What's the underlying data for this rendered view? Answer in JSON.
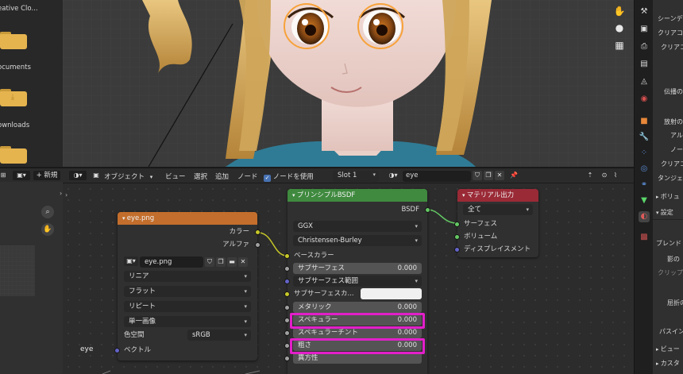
{
  "file_browser": {
    "items": [
      {
        "label": "eative Clo..."
      },
      {
        "label": "ocuments"
      },
      {
        "label": "ownloads"
      }
    ]
  },
  "image_editor": {
    "new_label": "新規"
  },
  "node_header": {
    "object_label": "オブジェクト",
    "menus": [
      "ビュー",
      "選択",
      "追加",
      "ノード"
    ],
    "use_nodes_label": "ノードを使用",
    "slot_label": "Slot 1",
    "material_name": "eye"
  },
  "nodes": {
    "image": {
      "title": "eye.png",
      "outputs": [
        "カラー",
        "アルファ"
      ],
      "image_name": "eye.png",
      "interpolation": "リニア",
      "projection": "フラット",
      "extension": "リピート",
      "source": "単一画像",
      "color_space_label": "色空間",
      "color_space_value": "sRGB",
      "vector_input": "ベクトル"
    },
    "bsdf": {
      "title": "プリンシプルBSDF",
      "output": "BSDF",
      "distribution": "GGX",
      "subsurface_method": "Christensen-Burley",
      "base_color": "ベースカラー",
      "fields": [
        {
          "label": "サブサーフェス",
          "value": "0.000"
        },
        {
          "label": "サブサーフェス範囲",
          "value": ""
        },
        {
          "label": "サブサーフェスカ...",
          "value": ""
        },
        {
          "label": "メタリック",
          "value": "0.000"
        },
        {
          "label": "スペキュラー",
          "value": "0.000"
        },
        {
          "label": "スペキュラーチント",
          "value": "0.000"
        },
        {
          "label": "粗さ",
          "value": "0.000"
        },
        {
          "label": "異方性",
          "value": ""
        }
      ]
    },
    "output": {
      "title": "マテリアル出力",
      "target": "全て",
      "inputs": [
        "サーフェス",
        "ボリューム",
        "ディスプレイスメント"
      ]
    }
  },
  "frame_label": "eye",
  "properties_panel": {
    "lines": [
      "シーンデ",
      "クリアコ",
      "クリアコ",
      "伝播の",
      "放射の",
      "アル",
      "ノー",
      "クリアコ",
      "タンジェ",
      "ボリュ",
      "設定",
      "ブレンド",
      "影の",
      "クリップ",
      "屈折の",
      "パスイン",
      "ビュー",
      "カスタ"
    ]
  },
  "colors": {
    "image_node_header": "#c36e2c",
    "bsdf_node_header": "#3f8a3f",
    "output_node_header": "#9a2a36",
    "highlight": "#e21fc9"
  }
}
